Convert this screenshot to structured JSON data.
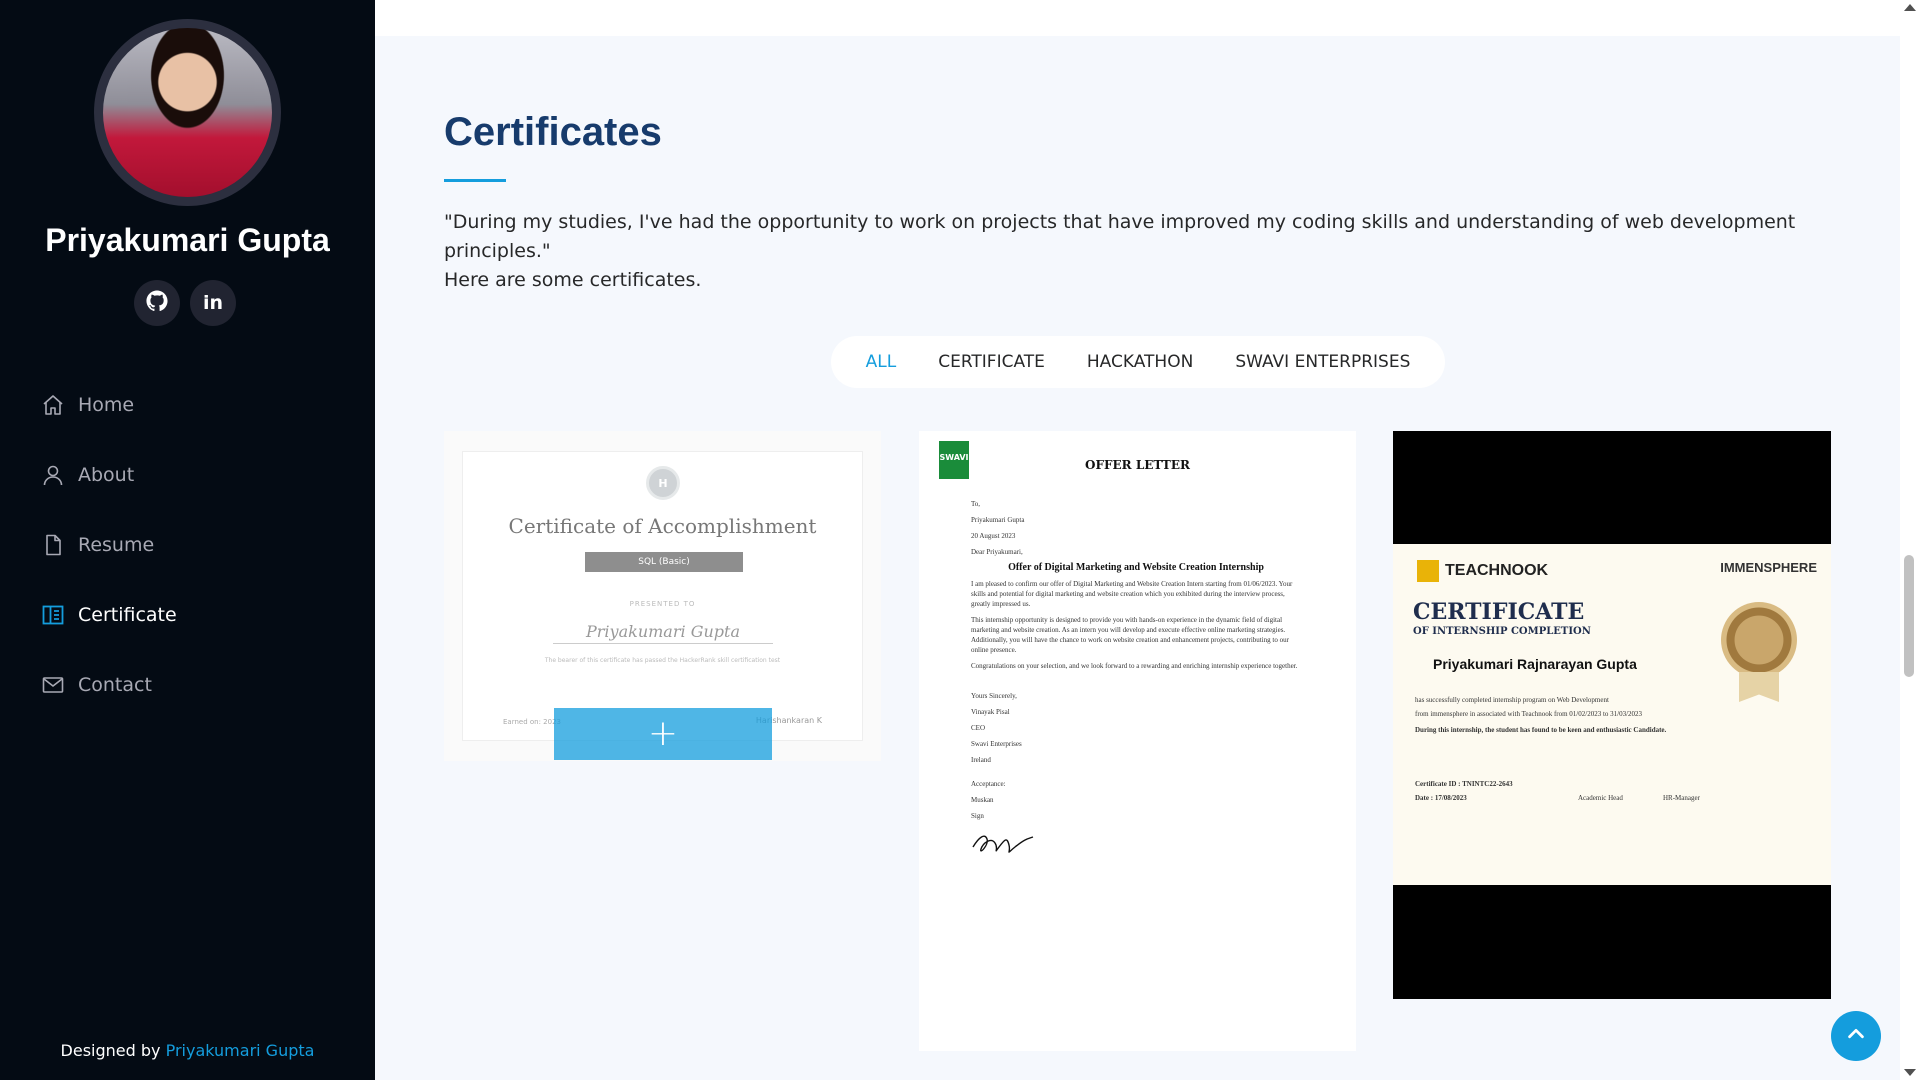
{
  "profile": {
    "name": "Priyakumari Gupta",
    "socials": [
      {
        "icon": "github-icon",
        "glyph": ""
      },
      {
        "icon": "linkedin-icon",
        "glyph": "in"
      }
    ]
  },
  "nav": {
    "items": [
      {
        "label": "Home",
        "icon": "home-icon"
      },
      {
        "label": "About",
        "icon": "user-icon"
      },
      {
        "label": "Resume",
        "icon": "file-icon"
      },
      {
        "label": "Certificate",
        "icon": "layout-icon",
        "active": true
      },
      {
        "label": "Contact",
        "icon": "envelope-icon"
      }
    ]
  },
  "footer": {
    "prefix": "Designed by",
    "link": "Priyakumari Gupta"
  },
  "section": {
    "title": "Certificates",
    "intro_line1": "\"During my studies, I've had the opportunity to work on projects that have improved my coding skills and understanding of web development principles.\"",
    "intro_line2": "Here are some certificates."
  },
  "filters": {
    "items": [
      "ALL",
      "CERTIFICATE",
      "HACKATHON",
      "SWAVI ENTERPRISES"
    ],
    "active": "ALL"
  },
  "cards": {
    "hackerrank": {
      "badge": "H",
      "title": "Certificate of Accomplishment",
      "skill": "SQL (Basic)",
      "presented": "PRESENTED TO",
      "name": "Priyakumari Gupta",
      "note": "The bearer of this certificate has passed the HackerRank skill certification test",
      "earned": "Earned on: 2023",
      "signer": "Harishankaran K",
      "overlay": "+"
    },
    "offer_letter": {
      "logo": "SWAVI",
      "title": "OFFER LETTER",
      "to": "To,",
      "recipient": "Priyakumari Gupta",
      "date": "20 August 2023",
      "greeting": "Dear Priyakumari,",
      "heading": "Offer of Digital Marketing and Website Creation Internship",
      "p1": "I am pleased to confirm our offer of Digital Marketing and Website Creation Intern starting from 01/06/2023. Your skills and potential for digital marketing and website creation which you exhibited during the interview process, greatly impressed us.",
      "p2": "This internship opportunity is designed to provide you with hands-on experience in the dynamic field of digital marketing and website creation. As an intern you will develop and execute effective online marketing strategies. Additionally, you will have the chance to work on website creation and enhancement projects, contributing to our online presence.",
      "p3": "Congratulations on your selection, and we look forward to a rewarding and enriching internship experience together.",
      "closing": "Yours Sincerely,",
      "signer": "Vinayak Pisal",
      "role": "CEO",
      "company": "Swavi Enterprises",
      "place": "Ireland",
      "acceptance": "Acceptance:",
      "accepter": "Muskan",
      "sign_label": "Sign"
    },
    "teachnook": {
      "brand": "TEACHNOOK",
      "partner": "IMMENSPHERE",
      "title": "CERTIFICATE",
      "subtitle": "OF INTERNSHIP COMPLETION",
      "name": "Priyakumari Rajnarayan Gupta",
      "line1": "has successfully completed internship program on  Web Development",
      "line2": "from immensphere in associated with Teachnook from  01/02/2023  to  31/03/2023",
      "line3": "During this internship, the student has found to be keen and enthusiastic Candidate.",
      "cert_id": "Certificate ID :  TNINTC22-2643",
      "date": "Date :   17/08/2023",
      "sig1": "Academic Head",
      "sig2": "HR-Manager"
    }
  },
  "colors": {
    "accent": "#149ddd",
    "sidebar_bg": "#040b14",
    "heading": "#173b6c"
  }
}
